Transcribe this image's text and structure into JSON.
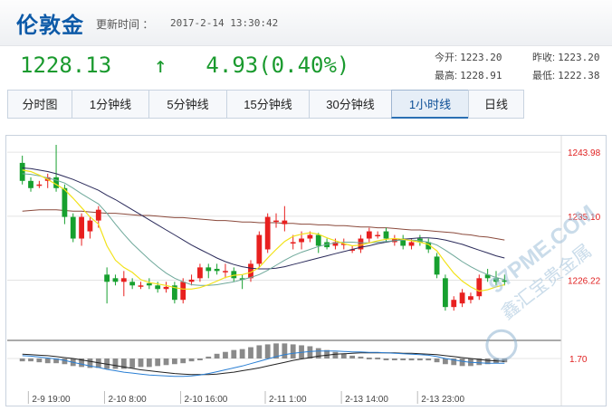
{
  "header": {
    "title": "伦敦金",
    "update_label": "更新时间 ：",
    "update_time": "2017-2-14 13:30:42"
  },
  "quote": {
    "price": "1228.13",
    "arrow": "↑",
    "change": "4.93(0.40%)",
    "open_label": "今开:",
    "open": "1223.20",
    "prev_close_label": "昨收:",
    "prev_close": "1223.20",
    "high_label": "最高:",
    "high": "1228.91",
    "low_label": "最低:",
    "low": "1222.38"
  },
  "tabs": [
    {
      "label": "分时图"
    },
    {
      "label": "1分钟线"
    },
    {
      "label": "5分钟线"
    },
    {
      "label": "15分钟线"
    },
    {
      "label": "30分钟线"
    },
    {
      "label": "1小时线",
      "active": true
    },
    {
      "label": "日线"
    }
  ],
  "watermark": {
    "line1": "97PME.COM",
    "line2": "鑫汇宝贵金属"
  },
  "colors": {
    "up": "#e8201f",
    "down": "#17a02f",
    "ma5": "#f2e21a",
    "ma10": "#6ea89a",
    "ma20": "#2a2a5a",
    "ma60": "#8b4a3c",
    "macd_dif": "#2a7fd4",
    "macd_dea": "#222222",
    "accent": "#0d5aa8"
  },
  "chart_data": {
    "type": "candlestick",
    "y_ticks": [
      "1243.98",
      "1235.10",
      "1226.22"
    ],
    "indicator_tick": "1.70",
    "x_ticks": [
      "2-9 19:00",
      "2-10 8:00",
      "2-10 16:00",
      "2-11 1:00",
      "2-13 14:00",
      "2-13 23:00"
    ],
    "ylim": [
      1218,
      1245
    ],
    "candles": [
      [
        1242.5,
        1240.0,
        1243.5,
        1239.5
      ],
      [
        1240.0,
        1239.0,
        1240.5,
        1238.5
      ],
      [
        1239.5,
        1239.5,
        1240.0,
        1239.0
      ],
      [
        1240.0,
        1240.5,
        1241.0,
        1239.0
      ],
      [
        1240.5,
        1239.0,
        1245.0,
        1238.5
      ],
      [
        1239.0,
        1235.0,
        1239.5,
        1234.0
      ],
      [
        1235.0,
        1232.0,
        1235.5,
        1231.5
      ],
      [
        1232.0,
        1235.0,
        1235.5,
        1231.0
      ],
      [
        1233.0,
        1234.5,
        1235.0,
        1232.0
      ],
      [
        1234.5,
        1236.0,
        1236.5,
        1233.5
      ],
      [
        1227.0,
        1226.0,
        1228.0,
        1223.0
      ],
      [
        1226.5,
        1226.0,
        1227.0,
        1225.5
      ],
      [
        1226.0,
        1226.5,
        1227.5,
        1224.0
      ],
      [
        1226.0,
        1225.5,
        1226.5,
        1225.0
      ],
      [
        1225.5,
        1225.5,
        1226.0,
        1225.0
      ],
      [
        1225.8,
        1225.5,
        1226.5,
        1225.0
      ],
      [
        1225.5,
        1225.0,
        1226.0,
        1224.5
      ],
      [
        1225.0,
        1225.3,
        1226.0,
        1224.5
      ],
      [
        1225.5,
        1223.5,
        1226.0,
        1223.0
      ],
      [
        1223.5,
        1226.0,
        1226.5,
        1223.0
      ],
      [
        1226.0,
        1226.3,
        1227.0,
        1225.5
      ],
      [
        1226.5,
        1228.0,
        1228.5,
        1226.0
      ],
      [
        1228.0,
        1227.5,
        1228.5,
        1226.5
      ],
      [
        1227.8,
        1227.5,
        1228.5,
        1227.0
      ],
      [
        1227.5,
        1227.5,
        1228.5,
        1226.5
      ],
      [
        1227.5,
        1226.5,
        1228.0,
        1226.0
      ],
      [
        1226.5,
        1226.3,
        1227.0,
        1225.0
      ],
      [
        1226.5,
        1228.5,
        1229.0,
        1226.0
      ],
      [
        1228.5,
        1232.5,
        1233.0,
        1228.0
      ],
      [
        1230.5,
        1235.0,
        1235.5,
        1230.0
      ],
      [
        1234.5,
        1234.5,
        1235.5,
        1233.5
      ],
      [
        1234.0,
        1234.5,
        1236.5,
        1233.0
      ],
      [
        1231.5,
        1231.5,
        1232.5,
        1230.5
      ],
      [
        1231.5,
        1232.0,
        1233.0,
        1230.5
      ],
      [
        1232.0,
        1232.5,
        1233.0,
        1231.5
      ],
      [
        1232.5,
        1231.0,
        1232.8,
        1230.0
      ],
      [
        1231.5,
        1230.8,
        1232.0,
        1230.5
      ],
      [
        1231.0,
        1231.5,
        1232.0,
        1230.5
      ],
      [
        1231.3,
        1231.3,
        1232.0,
        1230.5
      ],
      [
        1230.5,
        1230.5,
        1231.0,
        1230.0
      ],
      [
        1230.5,
        1232.0,
        1232.5,
        1230.0
      ],
      [
        1232.0,
        1233.0,
        1233.5,
        1231.5
      ],
      [
        1232.5,
        1232.5,
        1233.0,
        1232.0
      ],
      [
        1233.0,
        1232.0,
        1233.5,
        1231.5
      ],
      [
        1231.5,
        1232.0,
        1232.5,
        1231.0
      ],
      [
        1232.0,
        1231.0,
        1232.5,
        1230.5
      ],
      [
        1231.0,
        1231.5,
        1232.0,
        1230.5
      ],
      [
        1232.0,
        1231.5,
        1232.5,
        1231.0
      ],
      [
        1231.5,
        1230.5,
        1232.0,
        1230.0
      ],
      [
        1229.5,
        1227.0,
        1230.0,
        1226.5
      ],
      [
        1226.5,
        1222.5,
        1227.0,
        1222.0
      ],
      [
        1222.5,
        1223.5,
        1224.0,
        1222.0
      ],
      [
        1223.0,
        1224.5,
        1225.0,
        1222.5
      ],
      [
        1223.5,
        1224.0,
        1224.5,
        1223.0
      ],
      [
        1224.0,
        1226.5,
        1227.0,
        1223.5
      ],
      [
        1227.0,
        1226.5,
        1227.8,
        1226.0
      ],
      [
        1226.5,
        1226.0,
        1227.5,
        1225.5
      ],
      [
        1226.2,
        1226.0,
        1227.0,
        1225.5
      ]
    ],
    "ma5": [
      1241.5,
      1241.3,
      1240.8,
      1240.2,
      1239.5,
      1238.8,
      1237.6,
      1236.3,
      1235.0,
      1234.0,
      1231.0,
      1229.0,
      1228.0,
      1227.3,
      1226.3,
      1225.9,
      1225.7,
      1225.5,
      1225.2,
      1225.0,
      1225.0,
      1225.2,
      1225.6,
      1226.1,
      1226.6,
      1226.9,
      1227.0,
      1227.3,
      1228.0,
      1229.3,
      1230.5,
      1231.6,
      1232.3,
      1232.6,
      1232.8,
      1232.6,
      1232.1,
      1231.7,
      1231.3,
      1231.0,
      1231.1,
      1231.4,
      1231.7,
      1231.9,
      1232.0,
      1231.9,
      1231.7,
      1231.5,
      1231.2,
      1230.3,
      1228.7,
      1227.2,
      1226.1,
      1225.3,
      1224.7,
      1224.9,
      1225.3,
      1225.6
    ],
    "ma10": [
      1241.0,
      1240.9,
      1240.7,
      1240.4,
      1240.1,
      1239.7,
      1239.0,
      1238.2,
      1237.5,
      1236.8,
      1235.5,
      1234.0,
      1232.6,
      1231.3,
      1230.2,
      1229.1,
      1228.1,
      1227.2,
      1226.5,
      1226.0,
      1225.6,
      1225.5,
      1225.5,
      1225.6,
      1225.8,
      1226.0,
      1226.3,
      1226.6,
      1227.0,
      1227.6,
      1228.3,
      1229.0,
      1229.6,
      1230.1,
      1230.5,
      1230.9,
      1231.2,
      1231.4,
      1231.5,
      1231.5,
      1231.4,
      1231.4,
      1231.5,
      1231.6,
      1231.7,
      1231.8,
      1231.8,
      1231.7,
      1231.5,
      1231.1,
      1230.4,
      1229.6,
      1228.8,
      1228.1,
      1227.5,
      1227.0,
      1226.6,
      1226.3
    ],
    "ma20": [
      1241.8,
      1241.7,
      1241.5,
      1241.3,
      1241.0,
      1240.6,
      1240.2,
      1239.7,
      1239.2,
      1238.7,
      1238.0,
      1237.4,
      1236.7,
      1236.0,
      1235.3,
      1234.6,
      1233.9,
      1233.2,
      1232.5,
      1231.8,
      1231.1,
      1230.5,
      1229.9,
      1229.3,
      1228.8,
      1228.4,
      1228.1,
      1227.9,
      1227.8,
      1227.8,
      1227.9,
      1228.1,
      1228.4,
      1228.7,
      1229.0,
      1229.3,
      1229.6,
      1229.9,
      1230.2,
      1230.5,
      1230.8,
      1231.0,
      1231.3,
      1231.5,
      1231.7,
      1231.9,
      1232.0,
      1232.1,
      1232.1,
      1232.0,
      1231.8,
      1231.5,
      1231.2,
      1230.8,
      1230.4,
      1230.0,
      1229.6,
      1229.3
    ],
    "ma60": [
      1235.8,
      1235.9,
      1236.0,
      1236.0,
      1236.0,
      1235.9,
      1235.8,
      1235.8,
      1235.7,
      1235.6,
      1235.5,
      1235.5,
      1235.4,
      1235.3,
      1235.2,
      1235.2,
      1235.1,
      1235.0,
      1234.9,
      1234.9,
      1234.8,
      1234.7,
      1234.6,
      1234.5,
      1234.5,
      1234.4,
      1234.3,
      1234.3,
      1234.2,
      1234.2,
      1234.2,
      1234.1,
      1234.1,
      1234.0,
      1234.0,
      1233.9,
      1233.9,
      1233.8,
      1233.8,
      1233.7,
      1233.6,
      1233.6,
      1233.5,
      1233.5,
      1233.4,
      1233.3,
      1233.2,
      1233.2,
      1233.1,
      1233.0,
      1232.9,
      1232.8,
      1232.6,
      1232.5,
      1232.3,
      1232.2,
      1232.0,
      1231.8
    ],
    "macd_dif": [
      0.6,
      0.5,
      0.3,
      0.1,
      -0.1,
      -0.4,
      -0.8,
      -1.2,
      -1.6,
      -1.9,
      -2.3,
      -2.6,
      -2.9,
      -3.1,
      -3.3,
      -3.5,
      -3.6,
      -3.7,
      -3.8,
      -3.8,
      -3.7,
      -3.5,
      -3.2,
      -2.8,
      -2.4,
      -2.0,
      -1.6,
      -1.1,
      -0.6,
      -0.1,
      0.4,
      0.8,
      1.1,
      1.3,
      1.5,
      1.6,
      1.6,
      1.6,
      1.5,
      1.4,
      1.4,
      1.3,
      1.3,
      1.2,
      1.1,
      1.0,
      0.9,
      0.8,
      0.7,
      0.4,
      0.0,
      -0.3,
      -0.6,
      -0.8,
      -0.9,
      -1.0,
      -1.0,
      -1.0
    ],
    "macd_dea": [
      0.9,
      0.8,
      0.7,
      0.6,
      0.4,
      0.2,
      0.0,
      -0.3,
      -0.6,
      -0.9,
      -1.2,
      -1.5,
      -1.8,
      -2.1,
      -2.4,
      -2.6,
      -2.8,
      -3.0,
      -3.2,
      -3.3,
      -3.4,
      -3.4,
      -3.4,
      -3.3,
      -3.1,
      -2.9,
      -2.6,
      -2.3,
      -2.0,
      -1.6,
      -1.2,
      -0.8,
      -0.4,
      -0.1,
      0.2,
      0.5,
      0.7,
      0.9,
      1.0,
      1.1,
      1.2,
      1.2,
      1.2,
      1.2,
      1.2,
      1.1,
      1.1,
      1.0,
      0.9,
      0.8,
      0.6,
      0.4,
      0.2,
      0.0,
      -0.2,
      -0.4,
      -0.5,
      -0.6
    ],
    "macd_hist": [
      -0.6,
      -0.6,
      -0.8,
      -1.0,
      -1.0,
      -1.2,
      -1.6,
      -1.8,
      -2.0,
      -2.0,
      -2.2,
      -2.2,
      -2.2,
      -2.0,
      -1.8,
      -1.8,
      -1.6,
      -1.4,
      -1.2,
      -1.0,
      -0.6,
      -0.2,
      0.4,
      1.0,
      1.4,
      1.8,
      2.0,
      2.4,
      2.8,
      3.0,
      3.2,
      3.2,
      3.0,
      2.8,
      2.6,
      2.2,
      1.8,
      1.4,
      1.0,
      0.6,
      0.4,
      0.2,
      0.2,
      0.0,
      -0.2,
      -0.2,
      -0.4,
      -0.4,
      -0.4,
      -0.8,
      -1.2,
      -1.4,
      -1.6,
      -1.6,
      -1.4,
      -1.2,
      -1.0,
      -0.8
    ]
  }
}
